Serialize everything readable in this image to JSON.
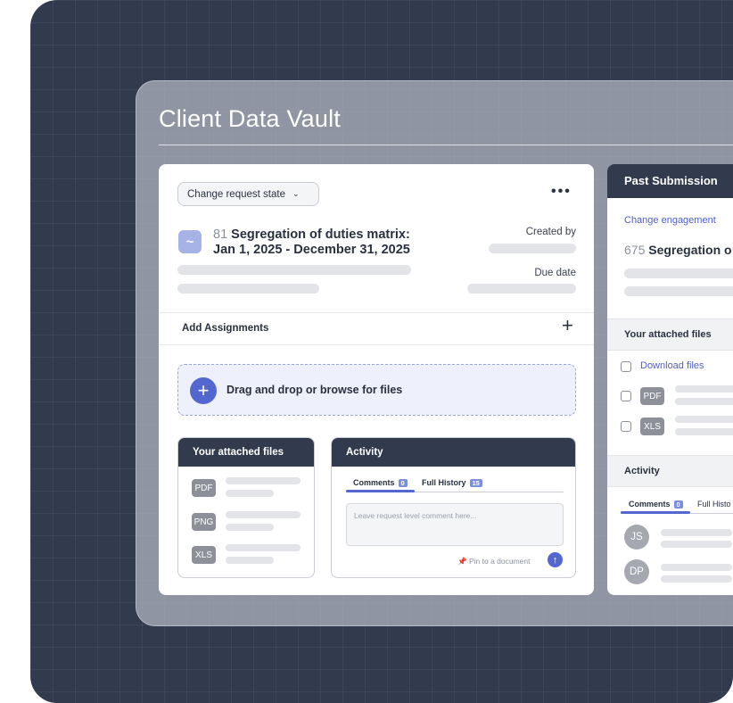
{
  "panel": {
    "title": "Client Data Vault"
  },
  "request": {
    "state_button": "Change request state",
    "more_icon": "•••",
    "number": "81",
    "title_line1": "Segregation of duties matrix:",
    "title_line2": "Jan 1, 2025 - December 31, 2025",
    "created_by_label": "Created by",
    "due_date_label": "Due date",
    "icon_glyph": "~"
  },
  "assignments": {
    "label": "Add Assignments",
    "plus": "+"
  },
  "dropzone": {
    "plus": "+",
    "text": "Drag and drop or browse for files"
  },
  "attached_files": {
    "title": "Your attached files",
    "files": [
      "PDF",
      "PNG",
      "XLS"
    ]
  },
  "activity": {
    "title": "Activity",
    "tab_comments": "Comments",
    "comments_count": "0",
    "tab_history": "Full History",
    "history_count": "15",
    "placeholder": "Leave request level comment here...",
    "pin_label": "Pin to a document",
    "send_glyph": "↑"
  },
  "past_submission": {
    "title": "Past Submission",
    "change_engagement": "Change engagement",
    "number": "675",
    "title_text": "Segregation o",
    "attached_title": "Your attached files",
    "download_label": "Download files",
    "files": [
      "PDF",
      "XLS"
    ],
    "activity_title": "Activity",
    "tab_comments": "Comments",
    "comments_count": "0",
    "tab_history": "Full Histo",
    "avatars": [
      "JS",
      "DP"
    ]
  },
  "colors": {
    "background": "#323a4d",
    "accent": "#5467d0",
    "header": "#323a4d"
  }
}
